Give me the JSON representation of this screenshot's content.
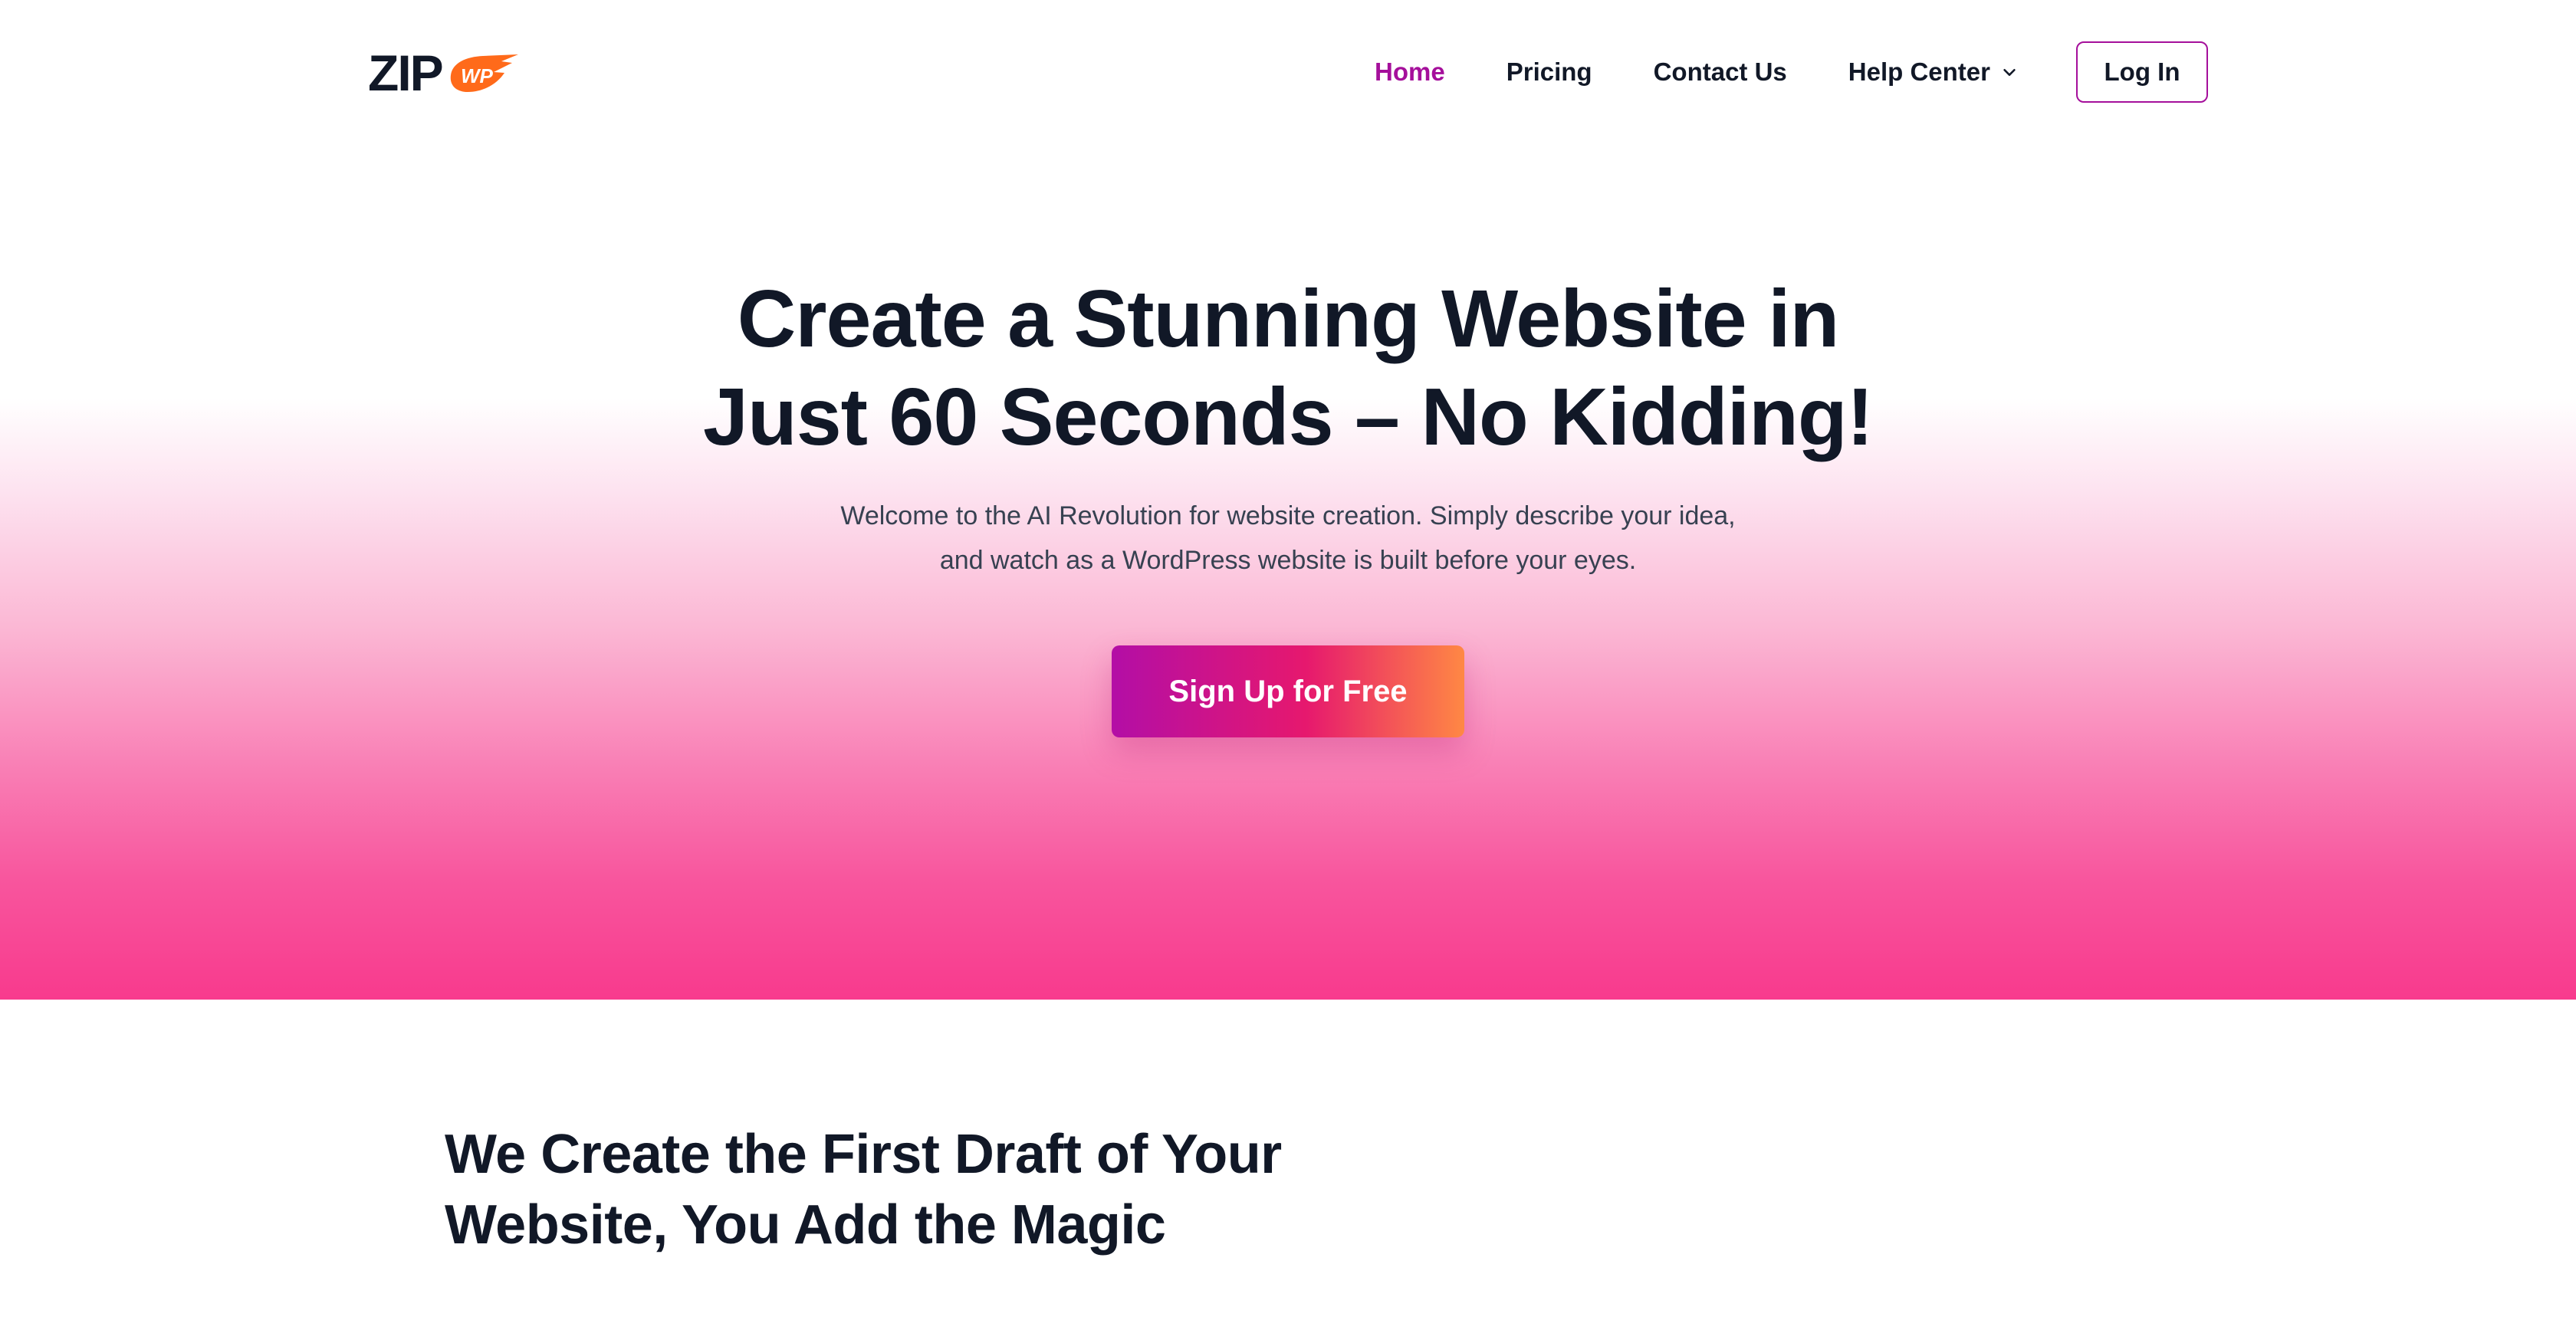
{
  "brand": {
    "logo_text": "ZIP",
    "logo_badge": "WP",
    "accent": "#a50f9b",
    "orange": "#ff6a1a"
  },
  "nav": {
    "items": [
      {
        "label": "Home",
        "active": true
      },
      {
        "label": "Pricing",
        "active": false
      },
      {
        "label": "Contact Us",
        "active": false
      },
      {
        "label": "Help Center",
        "active": false,
        "icon": "chevron-down-icon"
      }
    ],
    "login_label": "Log In"
  },
  "hero": {
    "title_lines": [
      "Create a Stunning Website in",
      "Just 60 Seconds – No Kidding!"
    ],
    "subtitle_lines": [
      "Welcome to the AI Revolution for website creation. Simply describe your idea,",
      "and watch as a WordPress website is built before your eyes."
    ],
    "cta_label": "Sign Up for Free"
  },
  "section": {
    "title_lines": [
      "We Create the First Draft of Your",
      "Website, You Add the Magic"
    ]
  }
}
